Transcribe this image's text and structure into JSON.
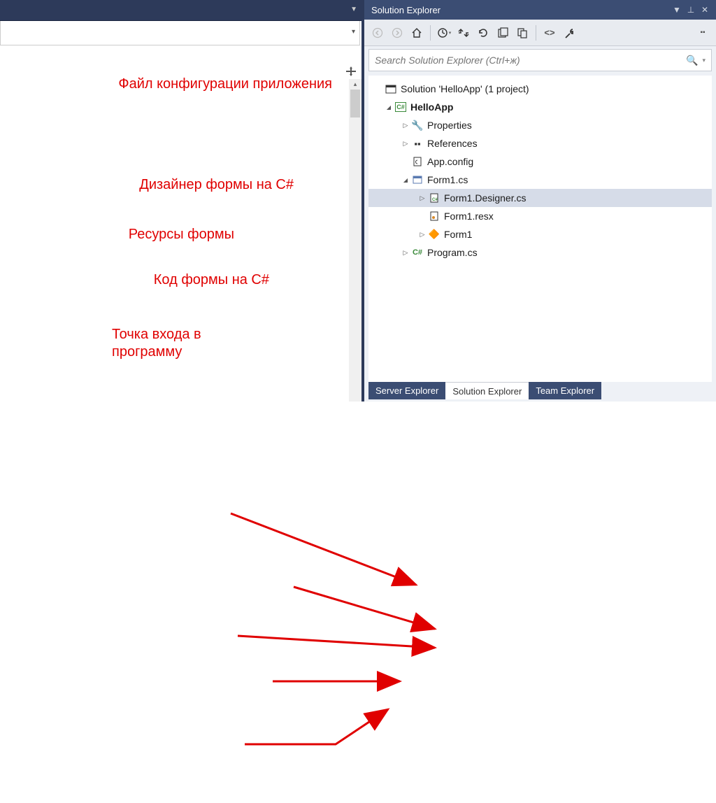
{
  "panel": {
    "title": "Solution Explorer",
    "search_placeholder": "Search Solution Explorer (Ctrl+ж)"
  },
  "tree": {
    "solution": "Solution 'HelloApp' (1 project)",
    "project": "HelloApp",
    "properties": "Properties",
    "references": "References",
    "appconfig": "App.config",
    "form1cs": "Form1.cs",
    "form1designer": "Form1.Designer.cs",
    "form1resx": "Form1.resx",
    "form1class": "Form1",
    "programcs": "Program.cs"
  },
  "tabs": {
    "server": "Server Explorer",
    "solution": "Solution Explorer",
    "team": "Team Explorer"
  },
  "annotations": {
    "appconfig": "Файл конфигурации приложения",
    "designer": "Дизайнер формы на C#",
    "resources": "Ресурсы формы",
    "code": "Код формы на C#",
    "entry": "Точка входа в программу"
  }
}
